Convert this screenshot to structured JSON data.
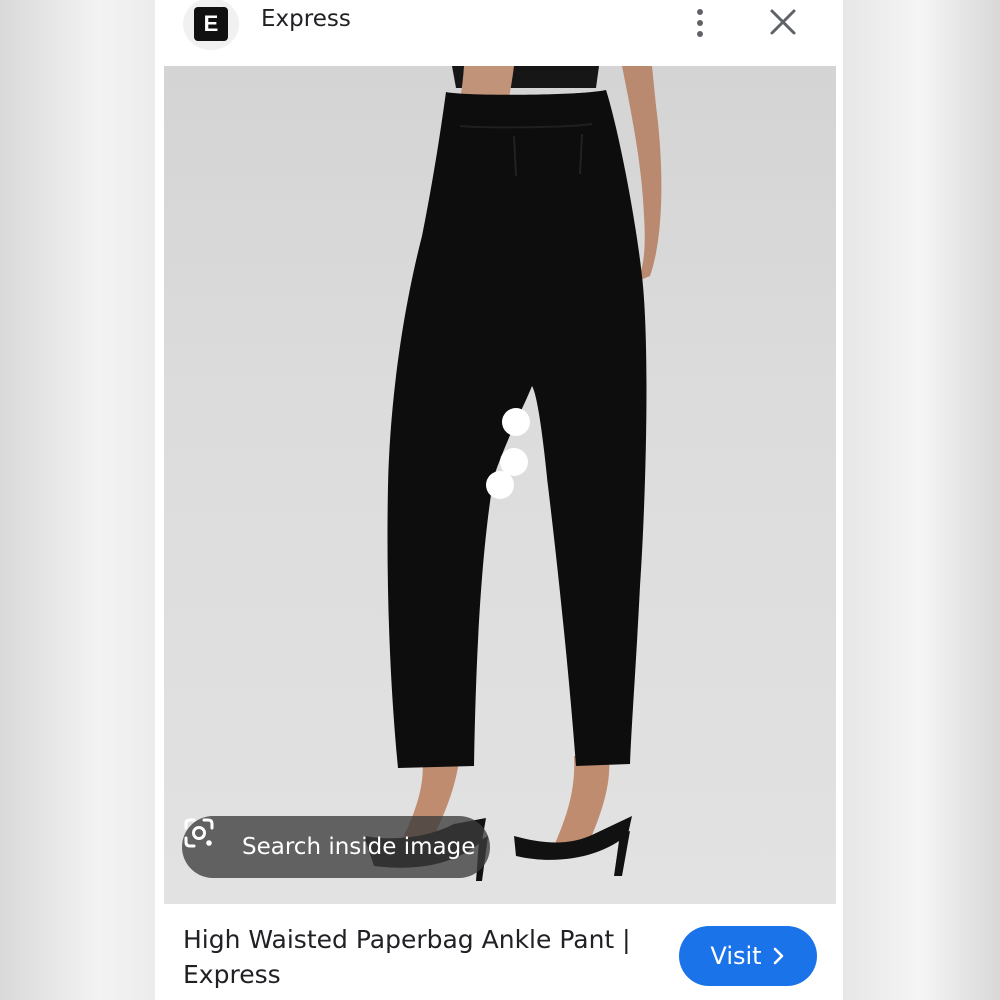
{
  "header": {
    "favicon_letter": "E",
    "site_name": "Express"
  },
  "icons": {
    "site_favicon": "express-logo-icon",
    "more": "more-vert-icon",
    "close": "close-icon",
    "lens": "lens-camera-icon",
    "chevron": "chevron-right-icon"
  },
  "image": {
    "lens_label": "Search inside image"
  },
  "result": {
    "title_line1": "High Waisted Paperbag Ankle Pant |",
    "title_line2": "Express",
    "visit_label": "Visit"
  },
  "colors": {
    "accent": "#1a73e8",
    "chip_bg": "#3c3c3c",
    "text": "#202124"
  }
}
